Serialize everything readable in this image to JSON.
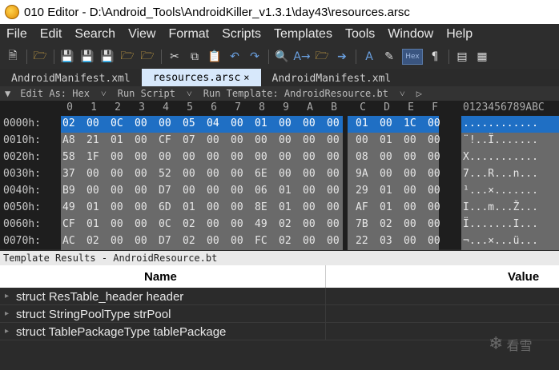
{
  "window": {
    "title": "010 Editor - D:\\Android_Tools\\AndroidKiller_v1.3.1\\day43\\resources.arsc"
  },
  "menu": [
    "File",
    "Edit",
    "Search",
    "View",
    "Format",
    "Scripts",
    "Templates",
    "Tools",
    "Window",
    "Help"
  ],
  "toolbar": {
    "icons": [
      "new-file-icon",
      "open-folder-icon",
      "save-icon",
      "save-as-icon",
      "save-all-icon",
      "open-folder-icon",
      "open-folder-icon",
      "cut-icon",
      "copy-icon",
      "paste-icon",
      "undo-icon",
      "redo-icon",
      "find-icon",
      "replace-icon",
      "find-in-files-icon",
      "goto-icon",
      "font-icon",
      "highlight-icon",
      "hex-mode-icon",
      "paragraph-icon",
      "columns-icon",
      "grid-icon"
    ],
    "hex_label": "Hex"
  },
  "tabs": [
    {
      "label": "AndroidManifest.xml",
      "active": false
    },
    {
      "label": "resources.arsc",
      "active": true,
      "close": "×"
    },
    {
      "label": "AndroidManifest.xml",
      "active": false
    }
  ],
  "editbar": {
    "edit_as": "Edit As: Hex",
    "run_script": "Run Script",
    "run_template": "Run Template: AndroidResource.bt"
  },
  "hex": {
    "columns": [
      "0",
      "1",
      "2",
      "3",
      "4",
      "5",
      "6",
      "7",
      "8",
      "9",
      "A",
      "B",
      "C",
      "D",
      "E",
      "F"
    ],
    "ascii_header": "0123456789ABC",
    "rows": [
      {
        "addr": "0000h:",
        "bytes": [
          "02",
          "00",
          "0C",
          "00",
          "00",
          "05",
          "04",
          "00",
          "01",
          "00",
          "00",
          "00",
          "01",
          "00",
          "1C",
          "00"
        ],
        "ascii": "............",
        "selected": true
      },
      {
        "addr": "0010h:",
        "bytes": [
          "A8",
          "21",
          "01",
          "00",
          "CF",
          "07",
          "00",
          "00",
          "00",
          "00",
          "00",
          "00",
          "00",
          "01",
          "00",
          "00"
        ],
        "ascii": "¨!..Ï.......",
        "selected": false
      },
      {
        "addr": "0020h:",
        "bytes": [
          "58",
          "1F",
          "00",
          "00",
          "00",
          "00",
          "00",
          "00",
          "00",
          "00",
          "00",
          "00",
          "08",
          "00",
          "00",
          "00"
        ],
        "ascii": "X...........",
        "selected": false
      },
      {
        "addr": "0030h:",
        "bytes": [
          "37",
          "00",
          "00",
          "00",
          "52",
          "00",
          "00",
          "00",
          "6E",
          "00",
          "00",
          "00",
          "9A",
          "00",
          "00",
          "00"
        ],
        "ascii": "7...R...n...",
        "selected": false
      },
      {
        "addr": "0040h:",
        "bytes": [
          "B9",
          "00",
          "00",
          "00",
          "D7",
          "00",
          "00",
          "00",
          "06",
          "01",
          "00",
          "00",
          "29",
          "01",
          "00",
          "00"
        ],
        "ascii": "¹...×.......",
        "selected": false
      },
      {
        "addr": "0050h:",
        "bytes": [
          "49",
          "01",
          "00",
          "00",
          "6D",
          "01",
          "00",
          "00",
          "8E",
          "01",
          "00",
          "00",
          "AF",
          "01",
          "00",
          "00"
        ],
        "ascii": "I...m...Ž...",
        "selected": false
      },
      {
        "addr": "0060h:",
        "bytes": [
          "CF",
          "01",
          "00",
          "00",
          "0C",
          "02",
          "00",
          "00",
          "49",
          "02",
          "00",
          "00",
          "7B",
          "02",
          "00",
          "00"
        ],
        "ascii": "Ï.......I...",
        "selected": false
      },
      {
        "addr": "0070h:",
        "bytes": [
          "AC",
          "02",
          "00",
          "00",
          "D7",
          "02",
          "00",
          "00",
          "FC",
          "02",
          "00",
          "00",
          "22",
          "03",
          "00",
          "00"
        ],
        "ascii": "¬...×...ü...",
        "selected": false
      }
    ]
  },
  "template_results": {
    "title": "Template Results - AndroidResource.bt",
    "col_name": "Name",
    "col_value": "Value",
    "rows": [
      {
        "name": "struct ResTable_header header",
        "value": ""
      },
      {
        "name": "struct StringPoolType strPool",
        "value": ""
      },
      {
        "name": "struct TablePackageType tablePackage",
        "value": ""
      }
    ]
  },
  "watermark": {
    "text": "看雪"
  }
}
